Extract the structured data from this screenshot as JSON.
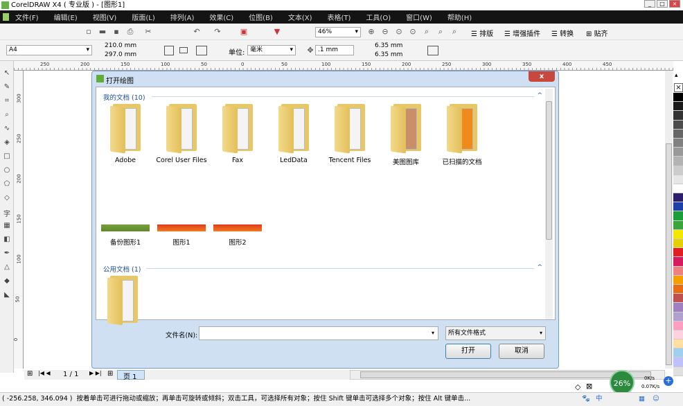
{
  "window": {
    "title": "CorelDRAW X4 ( 专业版 ) - [图形1]",
    "controls": [
      "_",
      "□",
      "×"
    ]
  },
  "menu": [
    "文件(F)",
    "编辑(E)",
    "视图(V)",
    "版面(L)",
    "排列(A)",
    "效果(C)",
    "位图(B)",
    "文本(X)",
    "表格(T)",
    "工具(O)",
    "窗口(W)",
    "帮助(H)"
  ],
  "toolbar": {
    "zoom": "46%",
    "plugins": [
      "排版",
      "增强插件",
      "转换",
      "贴齐"
    ]
  },
  "propbar": {
    "paper": "A4",
    "width": "210.0 mm",
    "height": "297.0 mm",
    "unit_label": "单位:",
    "unit": "毫米",
    "nudge": ".1 mm",
    "dup_x": "6.35 mm",
    "dup_y": "6.35 mm"
  },
  "rulers": {
    "h": [
      "250",
      "200",
      "150",
      "100",
      "50",
      "0",
      "50",
      "100",
      "150",
      "200",
      "250",
      "300",
      "350",
      "400",
      "450"
    ],
    "v": [
      "300",
      "250",
      "200",
      "150",
      "100",
      "50",
      "0"
    ]
  },
  "dialog": {
    "title": "打开绘图",
    "close": "x",
    "groups": [
      {
        "label": "我的文档 (10)",
        "folders": [
          "Adobe",
          "Corel User Files",
          "Fax",
          "LedData",
          "Tencent Files",
          "美图图库",
          "已扫描的文档"
        ],
        "files": [
          "备份图形1",
          "图形1",
          "图形2"
        ]
      },
      {
        "label": "公用文档 (1)"
      }
    ],
    "filename_label": "文件名(N):",
    "filename": "",
    "filetype": "所有文件格式",
    "open": "打开",
    "cancel": "取消"
  },
  "pagebar": {
    "counter": "1 / 1",
    "tab": "页 1"
  },
  "status": {
    "coords": "( -256.258, 346.094 )",
    "hint": "按着单击可进行拖动或缩放；再单击可旋转或倾斜；双击工具，可选择所有对象；按住 Shift 键单击可选择多个对象；按住 Alt 键单击..."
  },
  "netmon": {
    "percent": "26%",
    "up": "0K/s",
    "down": "0.07K/s"
  },
  "tray": {
    "ime": "中"
  },
  "colors": {
    "palette": [
      "#000000",
      "#1a1a1a",
      "#333333",
      "#4d4d4d",
      "#666666",
      "#808080",
      "#999999",
      "#b3b3b3",
      "#cccccc",
      "#e6e6e6",
      "#ffffff",
      "#2e1f6e",
      "#1f3fa8",
      "#1a9e3a",
      "#3aa63a",
      "#f5e600",
      "#e8d000",
      "#e02020",
      "#d81b60",
      "#f08080",
      "#f5a000",
      "#e86d10",
      "#c05050",
      "#a080c0",
      "#b0a0d0",
      "#ff9ec0",
      "#ffd0e0",
      "#ffe0a0",
      "#a0d0f0",
      "#c0c0ff",
      "#e0e0e0"
    ]
  }
}
